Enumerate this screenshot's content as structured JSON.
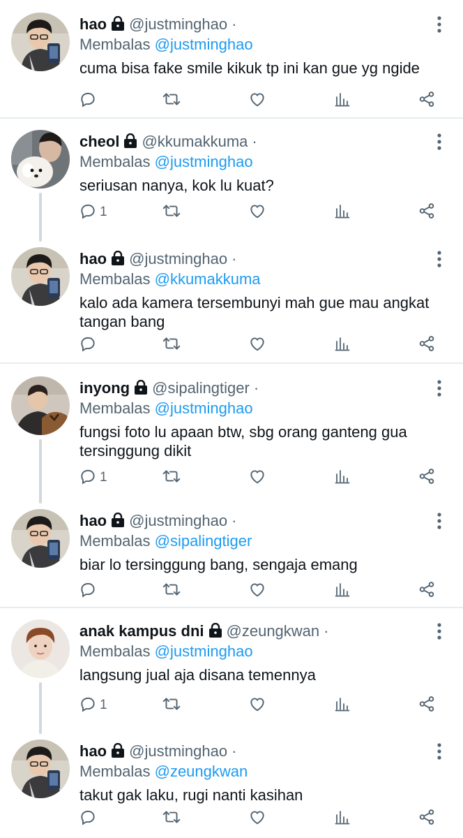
{
  "tweets": [
    {
      "name": "hao",
      "handle": "@justminghao",
      "dot": "·",
      "reply_prefix": "Membalas",
      "reply_to": "@justminghao",
      "text": "cuma bisa fake smile kikuk tp ini kan gue yg ngide",
      "reply_count": "",
      "avatar": "hao"
    },
    {
      "name": "cheol",
      "handle": "@kkumakkuma",
      "dot": "·",
      "reply_prefix": "Membalas",
      "reply_to": "@justminghao",
      "text": "seriusan nanya, kok lu kuat?",
      "reply_count": "1",
      "avatar": "cheol"
    },
    {
      "name": "hao",
      "handle": "@justminghao",
      "dot": "·",
      "reply_prefix": "Membalas",
      "reply_to": "@kkumakkuma",
      "text": "kalo ada kamera tersembunyi mah gue mau angkat tangan bang",
      "reply_count": "",
      "avatar": "hao"
    },
    {
      "name": "inyong",
      "handle": "@sipalingtiger",
      "dot": "·",
      "reply_prefix": "Membalas",
      "reply_to": "@justminghao",
      "text": "fungsi foto lu apaan btw, sbg orang ganteng gua tersinggung dikit",
      "reply_count": "1",
      "avatar": "inyong"
    },
    {
      "name": "hao",
      "handle": "@justminghao",
      "dot": "·",
      "reply_prefix": "Membalas",
      "reply_to": "@sipalingtiger",
      "text": "biar lo tersinggung bang, sengaja emang",
      "reply_count": "",
      "avatar": "hao"
    },
    {
      "name": "anak kampus dni",
      "handle": "@zeungkwan",
      "dot": "·",
      "reply_prefix": "Membalas",
      "reply_to": "@justminghao",
      "text": "langsung jual aja disana temennya",
      "reply_count": "1",
      "avatar": "zeungkwan"
    },
    {
      "name": "hao",
      "handle": "@justminghao",
      "dot": "·",
      "reply_prefix": "Membalas",
      "reply_to": "@zeungkwan",
      "text": "takut gak laku, rugi nanti kasihan",
      "reply_count": "",
      "avatar": "hao"
    }
  ],
  "icons": {
    "reply": "reply-icon",
    "retweet": "retweet-icon",
    "like": "heart-icon",
    "views": "analytics-icon",
    "share": "share-icon",
    "more": "more-icon",
    "lock": "lock-icon"
  },
  "colors": {
    "text": "#0f1419",
    "secondary": "#536471",
    "mention": "#1d9bf0",
    "thread_line": "#cfd9de",
    "divider": "#e6ecf0"
  }
}
